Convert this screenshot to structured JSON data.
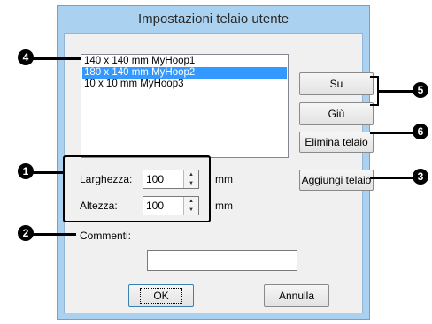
{
  "window": {
    "title": "Impostazioni telaio utente"
  },
  "hoop_list": {
    "items": [
      "140 x 140 mm MyHoop1",
      "180 x 140 mm MyHoop2",
      "10 x 10 mm MyHoop3"
    ],
    "selected_index": 1
  },
  "buttons": {
    "up": "Su",
    "down": "Giù",
    "delete": "Elimina telaio",
    "add": "Aggiungi telaio",
    "ok": "OK",
    "cancel": "Annulla"
  },
  "fields": {
    "width": {
      "label": "Larghezza:",
      "value": "100",
      "unit": "mm"
    },
    "height": {
      "label": "Altezza:",
      "value": "100",
      "unit": "mm"
    },
    "comment": {
      "label": "Commenti:",
      "value": ""
    }
  },
  "callouts": {
    "m1": "1",
    "m2": "2",
    "m3": "3",
    "m4": "4",
    "m5": "5",
    "m6": "6"
  },
  "colors": {
    "title_bar": "#aad2f0",
    "selection": "#3399ff",
    "dialog_bg": "#f0f0f0"
  }
}
